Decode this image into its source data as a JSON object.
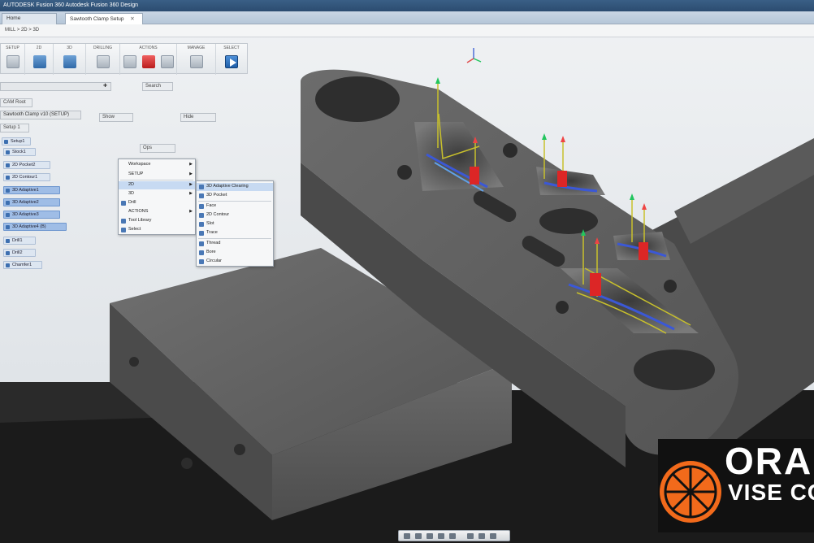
{
  "window": {
    "title": "AUTODESK Fusion 360 Autodesk Fusion 360 Design"
  },
  "tabs": [
    {
      "label": "Home",
      "active": false
    },
    {
      "label": "Sawtooth Clamp Setup",
      "active": true
    }
  ],
  "subbar": {
    "text": "MILL > 2D > 3D"
  },
  "ribbon": {
    "groups": [
      {
        "label": "SETUP"
      },
      {
        "label": "2D"
      },
      {
        "label": "3D"
      },
      {
        "label": "DRILLING"
      },
      {
        "label": "ACTIONS"
      },
      {
        "label": "MANAGE"
      },
      {
        "label": "SELECT"
      }
    ]
  },
  "browser": {
    "search_label": "",
    "btn_search": "Search",
    "btn_tabs": "CAM Root",
    "row_label": "Sawtooth Clamp v10 (SETUP)",
    "btn_show": "Show",
    "btn_hide": "Hide",
    "section": "Setup 1",
    "btn_ops": "Ops",
    "items": [
      {
        "label": "Setup1"
      },
      {
        "label": "Stock1"
      },
      {
        "label": "2D Pocket2"
      },
      {
        "label": "2D Contour1"
      },
      {
        "label": "3D Adaptive1"
      },
      {
        "label": "3D Adaptive2"
      },
      {
        "label": "3D Adaptive3"
      },
      {
        "label": "3D Adaptive4 (B)"
      },
      {
        "label": "Drill1"
      },
      {
        "label": "Drill2"
      },
      {
        "label": "Chamfer1"
      }
    ]
  },
  "context_menu": {
    "items": [
      {
        "label": "Workspace",
        "arrow": true
      },
      {
        "label": "SETUP",
        "arrow": true
      },
      {
        "label": "2D",
        "arrow": true,
        "selected": true
      },
      {
        "label": "3D",
        "arrow": true
      },
      {
        "label": "Drill",
        "arrow": false
      },
      {
        "label": "ACTIONS",
        "arrow": true
      },
      {
        "label": "Tool Library",
        "arrow": false
      },
      {
        "label": "Select",
        "arrow": false
      }
    ]
  },
  "submenu": {
    "items": [
      {
        "label": "3D Adaptive Clearing",
        "selected": true
      },
      {
        "label": "3D Pocket",
        "selected": false
      },
      {
        "label": "Face",
        "selected": false
      },
      {
        "label": "2D Contour",
        "selected": false
      },
      {
        "label": "Slot",
        "selected": false
      },
      {
        "label": "Trace",
        "selected": false
      },
      {
        "label": "Thread",
        "selected": false
      },
      {
        "label": "Bore",
        "selected": false
      },
      {
        "label": "Circular",
        "selected": false
      }
    ]
  },
  "viewport": {
    "brand_line1": "ORA",
    "brand_line2": "VISE CO",
    "colors": {
      "part": "#5d5d5d",
      "vise": "#1b1b1b",
      "sky": "#d7dde2",
      "accent_orange": "#f26a1b"
    }
  }
}
